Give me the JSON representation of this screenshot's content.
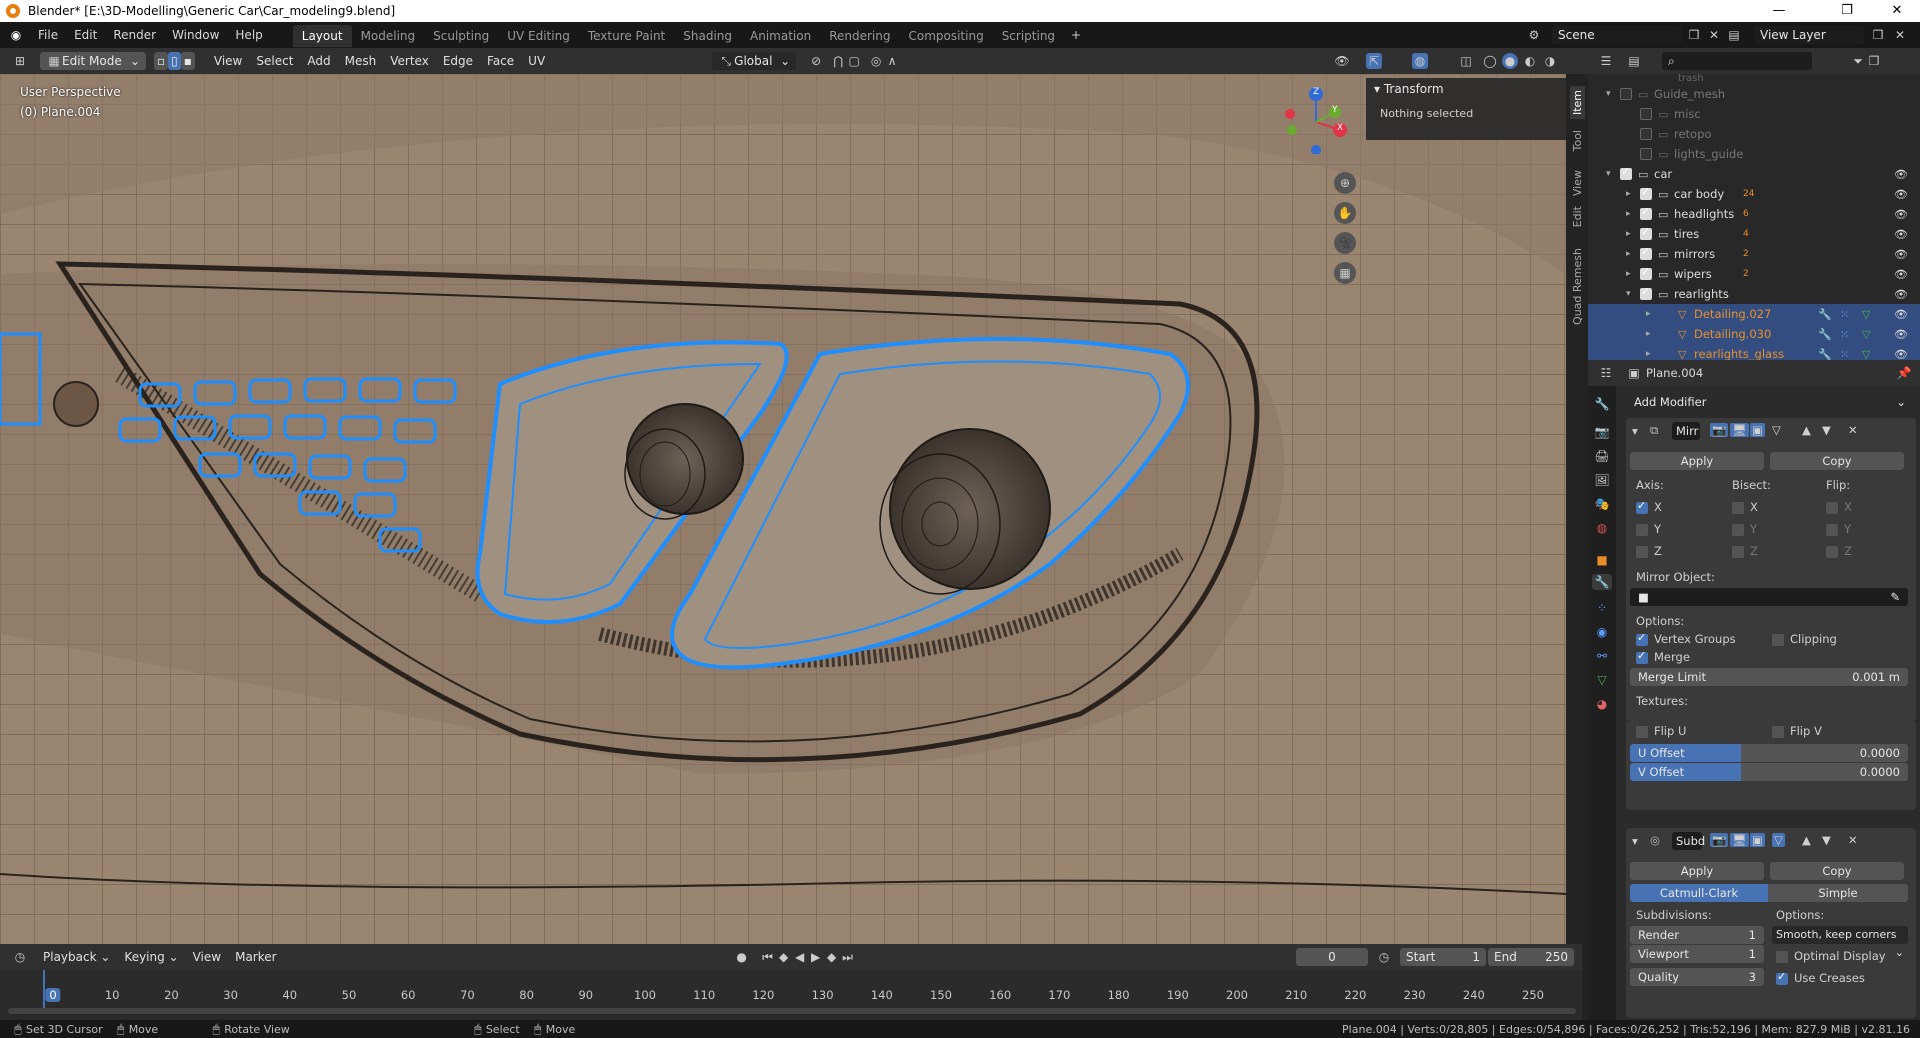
{
  "window": {
    "title": "Blender* [E:\\3D-Modelling\\Generic Car\\Car_modeling9.blend]"
  },
  "menu": [
    "File",
    "Edit",
    "Render",
    "Window",
    "Help"
  ],
  "workspaces": [
    "Layout",
    "Modeling",
    "Sculpting",
    "UV Editing",
    "Texture Paint",
    "Shading",
    "Animation",
    "Rendering",
    "Compositing",
    "Scripting"
  ],
  "active_workspace": "Layout",
  "scene": {
    "name": "Scene",
    "view_layer": "View Layer"
  },
  "viewport_header": {
    "mode": "Edit Mode",
    "menus": [
      "View",
      "Select",
      "Add",
      "Mesh",
      "Vertex",
      "Edge",
      "Face",
      "UV"
    ],
    "orientation": "Global"
  },
  "viewport": {
    "perspective": "User Perspective",
    "object": "(0) Plane.004"
  },
  "n_panel": {
    "title": "Transform",
    "content": "Nothing selected",
    "tabs": [
      "Item",
      "Tool",
      "View",
      "Edit",
      "Quad Remesh"
    ]
  },
  "gizmo": {
    "z": "Z",
    "y": "Y",
    "x": "X"
  },
  "outliner": {
    "rows": [
      {
        "name": "Guide_mesh",
        "indent": 1,
        "dim": true,
        "sel": false,
        "arrow": "▾"
      },
      {
        "name": "misc",
        "indent": 2,
        "dim": true,
        "sel": false,
        "arrow": ""
      },
      {
        "name": "retopo",
        "indent": 2,
        "dim": true,
        "sel": false,
        "arrow": ""
      },
      {
        "name": "lights_guide",
        "indent": 2,
        "dim": true,
        "sel": false,
        "arrow": ""
      },
      {
        "name": "car",
        "indent": 1,
        "dim": false,
        "sel": false,
        "arrow": "▾"
      },
      {
        "name": "car body",
        "indent": 2,
        "dim": false,
        "sel": false,
        "arrow": "▸",
        "badge": "24"
      },
      {
        "name": "headlights",
        "indent": 2,
        "dim": false,
        "sel": false,
        "arrow": "▸",
        "badge": "6"
      },
      {
        "name": "tires",
        "indent": 2,
        "dim": false,
        "sel": false,
        "arrow": "▸",
        "badge": "4"
      },
      {
        "name": "mirrors",
        "indent": 2,
        "dim": false,
        "sel": false,
        "arrow": "▸",
        "badge": "2"
      },
      {
        "name": "wipers",
        "indent": 2,
        "dim": false,
        "sel": false,
        "arrow": "▸",
        "badge": "2"
      },
      {
        "name": "rearlights",
        "indent": 2,
        "dim": false,
        "sel": false,
        "arrow": "▾"
      },
      {
        "name": "Detailing.027",
        "indent": 3,
        "dim": false,
        "sel": true,
        "arrow": "▸",
        "orange": true
      },
      {
        "name": "Detailing.030",
        "indent": 3,
        "dim": false,
        "sel": true,
        "arrow": "▸",
        "orange": true
      },
      {
        "name": "rearlights_glass",
        "indent": 3,
        "dim": false,
        "sel": true,
        "arrow": "▸",
        "orange": true
      }
    ],
    "top_partial": "trash"
  },
  "properties": {
    "object": "Plane.004",
    "add_modifier": "Add Modifier",
    "mirror": {
      "name": "Mirr",
      "apply": "Apply",
      "copy": "Copy",
      "axis": "Axis:",
      "bisect": "Bisect:",
      "flip": "Flip:",
      "x": "X",
      "y": "Y",
      "z": "Z",
      "mirror_object": "Mirror Object:",
      "options": "Options:",
      "vertex_groups": "Vertex Groups",
      "clipping": "Clipping",
      "merge": "Merge",
      "merge_limit": "Merge Limit",
      "merge_limit_value": "0.001 m",
      "textures": "Textures:",
      "flip_u": "Flip U",
      "flip_v": "Flip V",
      "u_offset": "U Offset",
      "u_offset_value": "0.0000",
      "v_offset": "V Offset",
      "v_offset_value": "0.0000"
    },
    "subd": {
      "name": "Subd",
      "apply": "Apply",
      "copy": "Copy",
      "catmull": "Catmull-Clark",
      "simple": "Simple",
      "subdivisions": "Subdivisions:",
      "options": "Options:",
      "render": "Render",
      "render_value": "1",
      "viewport": "Viewport",
      "viewport_value": "1",
      "quality": "Quality",
      "quality_value": "3",
      "uv_smooth": "Smooth, keep corners",
      "optimal_display": "Optimal Display",
      "use_creases": "Use Creases"
    }
  },
  "timeline": {
    "menus": [
      "Playback",
      "Keying",
      "View",
      "Marker"
    ],
    "current_frame": "0",
    "start_label": "Start",
    "start": "1",
    "end_label": "End",
    "end": "250",
    "ticks": [
      "0",
      "10",
      "20",
      "30",
      "40",
      "50",
      "60",
      "70",
      "80",
      "90",
      "100",
      "110",
      "120",
      "130",
      "140",
      "150",
      "160",
      "170",
      "180",
      "190",
      "200",
      "210",
      "220",
      "230",
      "240",
      "250"
    ]
  },
  "statusbar": {
    "items": [
      "Set 3D Cursor",
      "Move",
      "Rotate View",
      "Select",
      "Move"
    ],
    "stats": "Plane.004 | Verts:0/28,805 | Edges:0/54,896 | Faces:0/26,252 | Tris:52,196 | Mem: 827.9 MiB | v2.81.16"
  },
  "colors": {
    "accent": "#4772b3",
    "select": "#334d80",
    "mesh": "#9a8571",
    "wire_sel": "#1f8fff"
  }
}
